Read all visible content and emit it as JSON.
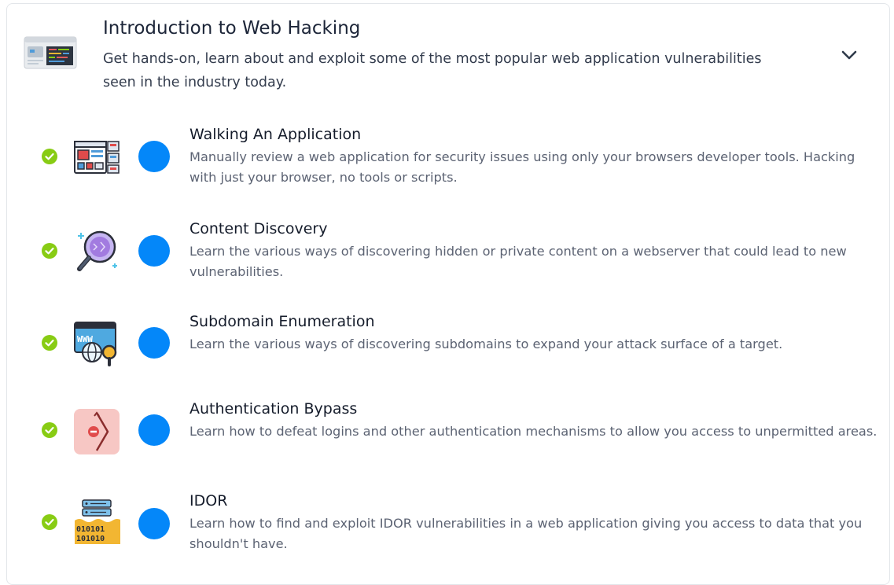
{
  "module": {
    "title": "Introduction to Web Hacking",
    "description": "Get hands-on, learn about and exploit some of the most popular web application vulnerabilities seen in the industry today.",
    "thumbnail_icon": "code-screen-icon",
    "toggle_icon": "chevron-down-icon"
  },
  "rooms": [
    {
      "title": "Walking An Application",
      "description": "Manually review a web application for security issues using only your browsers developer tools. Hacking with just your browser, no tools or scripts.",
      "icon": "web-application-layout-icon",
      "completed": true
    },
    {
      "title": "Content Discovery",
      "description": "Learn the various ways of discovering hidden or private content on a webserver that could lead to new vulnerabilities.",
      "icon": "magnifying-glass-icon",
      "completed": true
    },
    {
      "title": "Subdomain Enumeration",
      "description": "Learn the various ways of discovering subdomains to expand your attack surface of a target.",
      "icon": "www-globe-search-icon",
      "completed": true
    },
    {
      "title": "Authentication Bypass",
      "description": "Learn how to defeat logins and other authentication mechanisms to allow you access to unpermitted areas.",
      "icon": "bypass-arrow-icon",
      "completed": true
    },
    {
      "title": "IDOR",
      "description": "Learn how to find and exploit IDOR vulnerabilities in a web application giving you access to data that you shouldn't have.",
      "icon": "server-binary-icon",
      "completed": true
    }
  ],
  "colors": {
    "check_green": "#88cc14",
    "progress_dot": "#0487f9",
    "card_border": "#e3e6ea"
  }
}
